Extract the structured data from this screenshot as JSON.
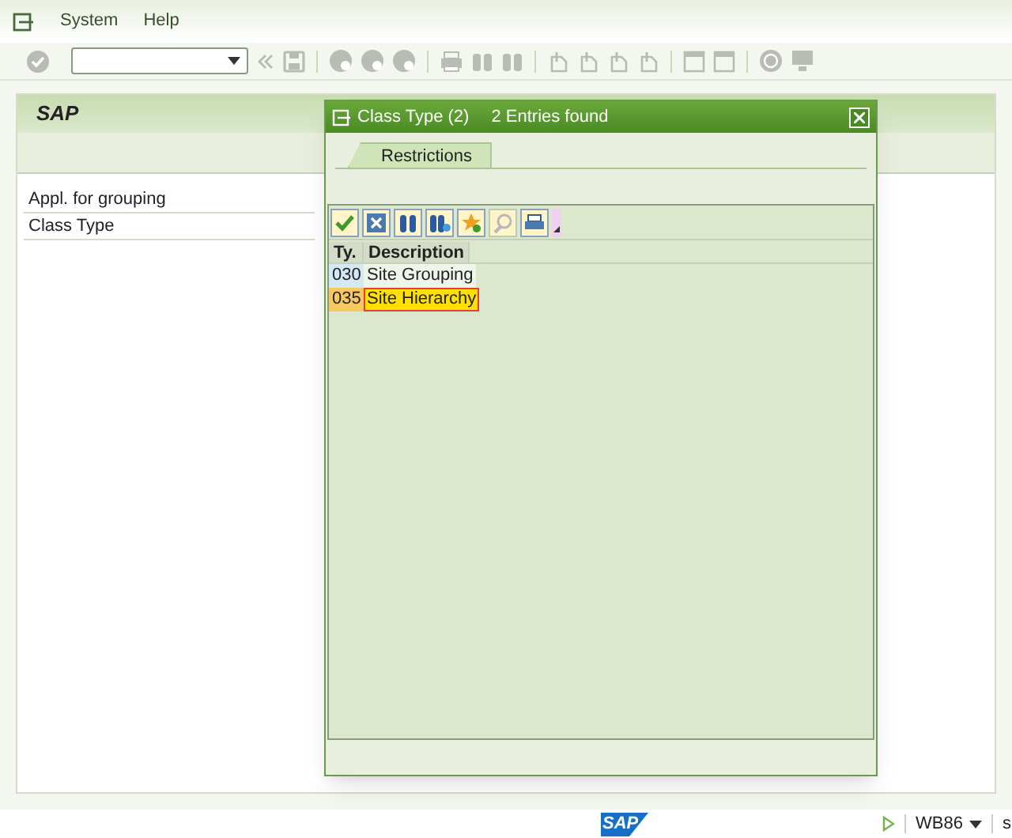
{
  "menu": [
    {
      "label": "System"
    },
    {
      "label": "Help"
    }
  ],
  "screen": {
    "title": "SAP",
    "fields": [
      "Appl. for grouping",
      "Class Type"
    ]
  },
  "dialog": {
    "title": "Class Type (2)",
    "subtitle": "2 Entries found",
    "tabs": [
      {
        "label": "Restrictions",
        "selected": true
      }
    ],
    "columns": [
      "Ty.",
      "Description"
    ],
    "rows": [
      {
        "cells": [
          "030",
          "Site Grouping"
        ],
        "selected": false
      },
      {
        "cells": [
          "035",
          "Site Hierarchy"
        ],
        "selected": true
      }
    ]
  },
  "footer": {
    "logo": "SAP",
    "system": "WB86",
    "cut": "s"
  }
}
